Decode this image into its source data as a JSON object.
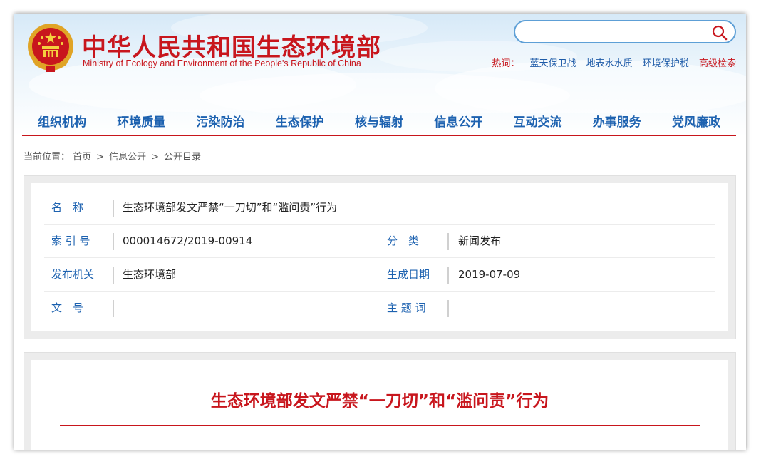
{
  "header": {
    "site_title": "中华人民共和国生态环境部",
    "site_subtitle": "Ministry of Ecology and Environment of the People's Republic of China",
    "search": {
      "placeholder": "",
      "icon": "search-icon"
    },
    "hot_label": "热词：",
    "hot_links": [
      "蓝天保卫战",
      "地表水水质",
      "环境保护税"
    ],
    "advanced_search": "高级检索"
  },
  "nav": [
    "组织机构",
    "环境质量",
    "污染防治",
    "生态保护",
    "核与辐射",
    "信息公开",
    "互动交流",
    "办事服务",
    "党风廉政"
  ],
  "breadcrumb": {
    "label": "当前位置：",
    "items": [
      "首页",
      "信息公开",
      "公开目录"
    ],
    "separator": ">"
  },
  "meta": {
    "name_label": "名　称",
    "name_value": "生态环境部发文严禁“一刀切”和“滥问责”行为",
    "index_label": "索 引 号",
    "index_value": "000014672/2019-00914",
    "category_label": "分　类",
    "category_value": "新闻发布",
    "publisher_label": "发布机关",
    "publisher_value": "生态环境部",
    "date_label": "生成日期",
    "date_value": "2019-07-09",
    "docno_label": "文　号",
    "docno_value": "",
    "topic_label": "主 题 词",
    "topic_value": ""
  },
  "article": {
    "title": "生态环境部发文严禁“一刀切”和“滥问责”行为"
  },
  "colors": {
    "brand_red": "#c8161d",
    "nav_blue": "#1d62b0",
    "link_blue": "#1e5ba8",
    "search_border": "#5d9fd6"
  }
}
